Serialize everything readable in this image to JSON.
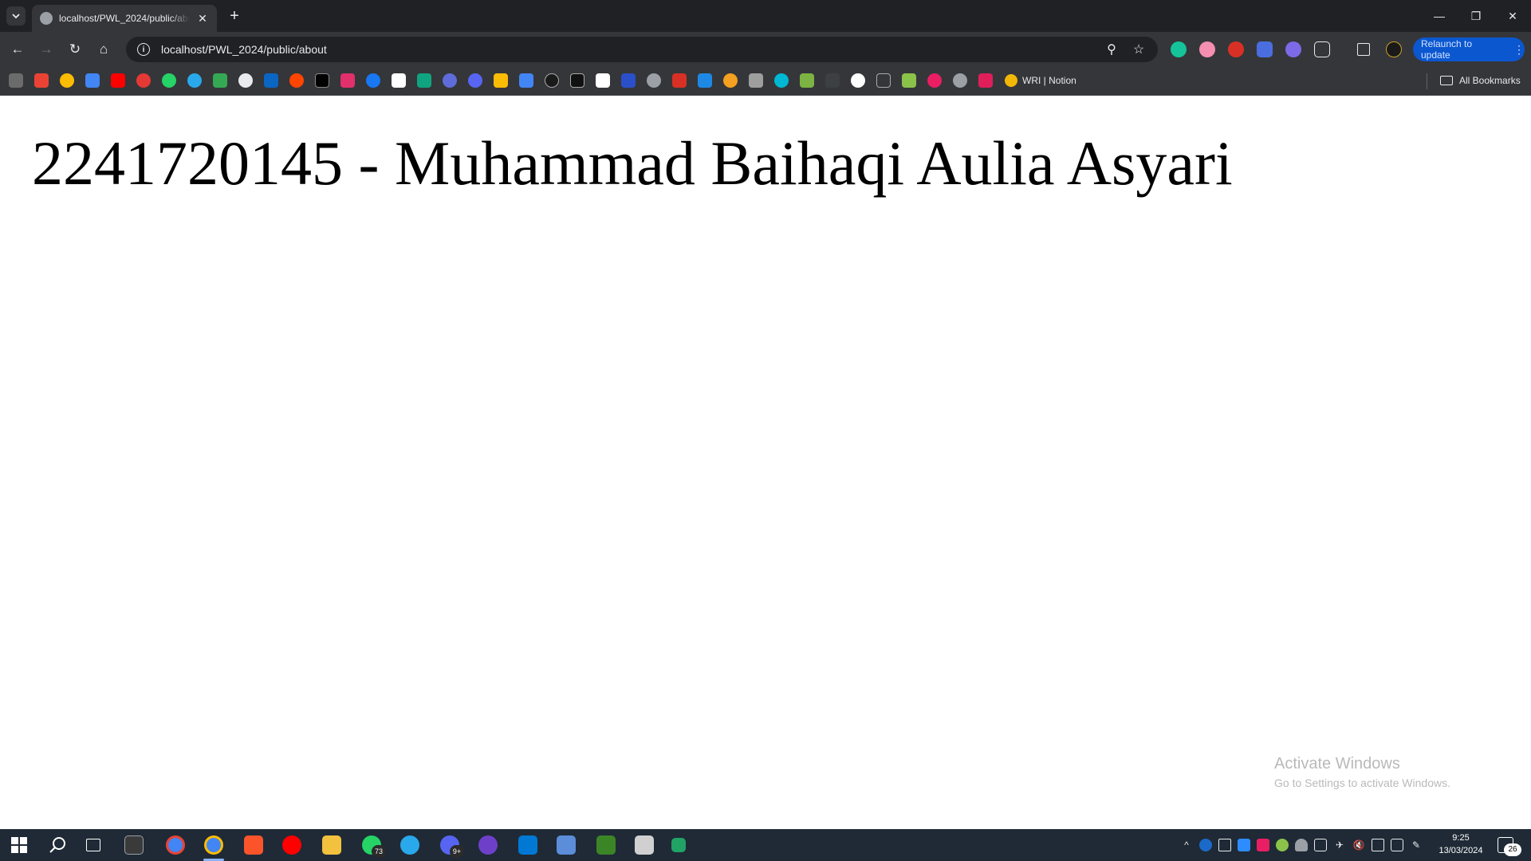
{
  "browser": {
    "tab": {
      "title": "localhost/PWL_2024/public/about",
      "close_glyph": "✕"
    },
    "new_tab_glyph": "+",
    "window_controls": {
      "minimize": "—",
      "restore": "❐",
      "close": "✕"
    },
    "toolbar": {
      "back_glyph": "←",
      "forward_glyph": "→",
      "reload_glyph": "↻",
      "home_glyph": "⌂",
      "url": "localhost/PWL_2024/public/about",
      "info_glyph": "i",
      "zoom_glyph": "⚲",
      "star_glyph": "☆",
      "relaunch_label": "Relaunch to update",
      "relaunch_menu_glyph": "⋮"
    },
    "bookmarks": {
      "notion_label": "WRI | Notion",
      "all_bookmarks_label": "All Bookmarks"
    }
  },
  "page": {
    "heading": "2241720145 - Muhammad Baihaqi Aulia Asyari"
  },
  "watermark": {
    "title": "Activate Windows",
    "subtitle": "Go to Settings to activate Windows."
  },
  "taskbar": {
    "whatsapp_badge": "73",
    "discord_badge": "9+",
    "time": "9:25",
    "date": "13/03/2024",
    "notification_count": "26"
  },
  "colors": {
    "chrome_dark": "#202124",
    "chrome_toolbar": "#35363a",
    "relaunch_blue": "#0b57d0",
    "taskbar": "#1f2a36"
  }
}
